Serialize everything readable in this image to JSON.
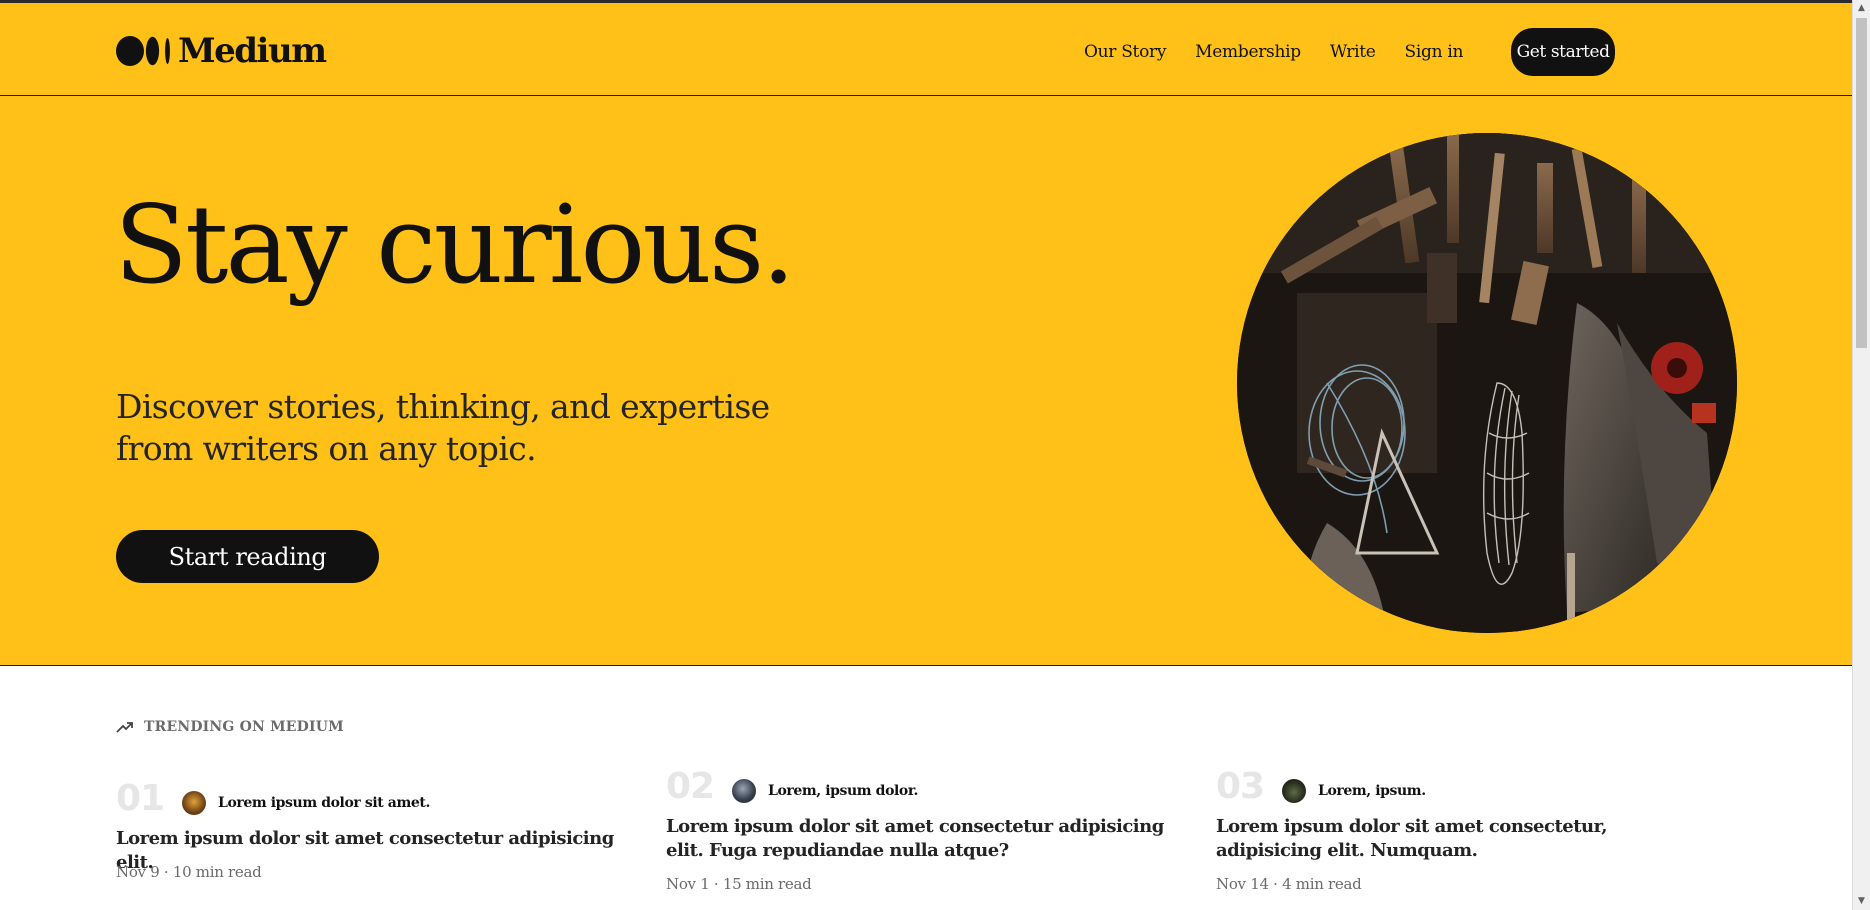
{
  "brand": {
    "name": "Medium"
  },
  "nav": {
    "items": [
      "Our Story",
      "Membership",
      "Write",
      "Sign in"
    ],
    "cta": "Get started"
  },
  "hero": {
    "title": "Stay curious.",
    "subtitle": "Discover stories, thinking, and expertise from writers on any topic.",
    "cta": "Start reading",
    "image_icon": "workshop-tools-photo"
  },
  "trending": {
    "heading": "TRENDING ON MEDIUM",
    "icon": "trending-up-icon",
    "cards": [
      {
        "number": "01",
        "author": "Lorem ipsum dolor sit amet.",
        "title": "Lorem ipsum dolor sit amet consectetur adipisicing elit.",
        "meta": "Nov 9 · 10 min read"
      },
      {
        "number": "02",
        "author": "Lorem, ipsum dolor.",
        "title": "Lorem ipsum dolor sit amet consectetur adipisicing elit. Fuga repudiandae nulla atque?",
        "meta": "Nov 1 · 15 min read"
      },
      {
        "number": "03",
        "author": "Lorem, ipsum.",
        "title": "Lorem ipsum dolor sit amet consectetur, adipisicing elit. Numquam.",
        "meta": "Nov 14 · 4 min read"
      }
    ]
  },
  "colors": {
    "brand_yellow": "#ffc017",
    "ink": "#111111",
    "muted": "#6b6b6b"
  }
}
